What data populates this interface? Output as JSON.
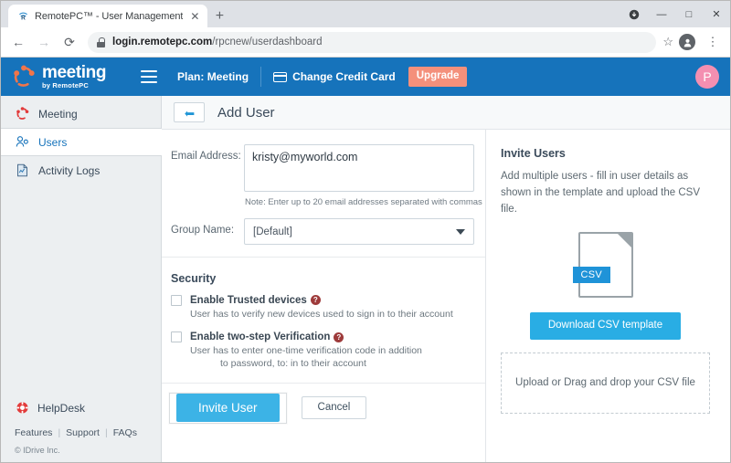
{
  "browser": {
    "tab": {
      "title": "RemotePC™ - User Management",
      "favicon": "remotepc-favicon",
      "close": "✕"
    },
    "newtab_label": "+",
    "window_controls": {
      "minimize": "—",
      "maximize": "□",
      "close": "✕",
      "downloads": "⬇"
    },
    "nav": {
      "back": "←",
      "forward": "→",
      "reload": "⟳"
    },
    "address": {
      "domain": "login.remotepc.com",
      "path": "/rpcnew/userdashboard"
    },
    "bookmark_star": "☆",
    "profile_initial": "👤",
    "menu": "⋮"
  },
  "appbar": {
    "logo_main": "meeting",
    "logo_sub": "by RemotePC",
    "plan": "Plan: Meeting",
    "change_credit_card": "Change Credit Card",
    "upgrade": "Upgrade",
    "avatar_initial": "P",
    "brand_color": "#1673bb",
    "upgrade_color": "#f4907b"
  },
  "sidebar": {
    "items": [
      {
        "label": "Meeting",
        "icon": "meeting-icon",
        "active": false
      },
      {
        "label": "Users",
        "icon": "users-icon",
        "active": true
      },
      {
        "label": "Activity Logs",
        "icon": "activity-logs-icon",
        "active": false
      }
    ],
    "helpdesk": "HelpDesk",
    "footer_links": [
      "Features",
      "Support",
      "FAQs"
    ],
    "separator": "|",
    "copyright": "© IDrive Inc."
  },
  "content": {
    "back_arrow": "↰",
    "title": "Add User",
    "form": {
      "email_label": "Email Address:",
      "email_value": "kristy@myworld.com",
      "email_note": "Note: Enter up to 20 email addresses separated with commas",
      "group_label": "Group Name:",
      "group_value": "[Default]",
      "security_title": "Security",
      "options": [
        {
          "label": "Enable Trusted devices",
          "help": "?",
          "desc": "User has to verify new devices used to sign in to their account",
          "desc2": "",
          "checked": false
        },
        {
          "label": "Enable two-step Verification",
          "help": "?",
          "desc": "User has to enter one-time verification code in addition",
          "desc2": "to password, to: in to their account",
          "checked": false
        }
      ],
      "invite_button": "Invite User",
      "cancel_button": "Cancel"
    },
    "invite_panel": {
      "title": "Invite Users",
      "description": "Add multiple users - fill in user details as shown in the template and upload the CSV file.",
      "csv_badge": "CSV",
      "download_button": "Download CSV template",
      "dropzone_text": "Upload or Drag and drop your CSV file"
    }
  }
}
